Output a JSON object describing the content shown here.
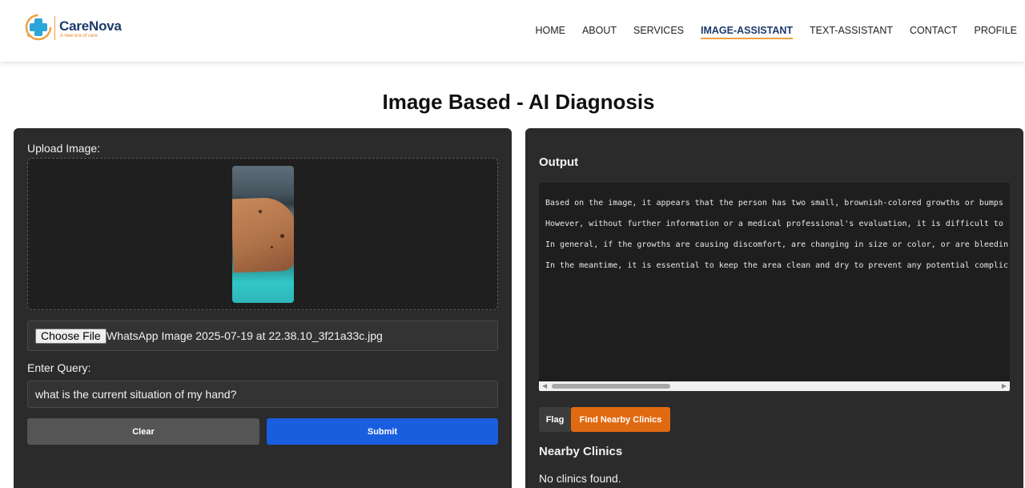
{
  "header": {
    "brand": "CareNova",
    "tagline": "A new era of care",
    "nav": [
      {
        "label": "HOME",
        "active": false
      },
      {
        "label": "ABOUT",
        "active": false
      },
      {
        "label": "SERVICES",
        "active": false
      },
      {
        "label": "IMAGE-ASSISTANT",
        "active": true
      },
      {
        "label": "TEXT-ASSISTANT",
        "active": false
      },
      {
        "label": "CONTACT",
        "active": false
      },
      {
        "label": "PROFILE",
        "active": false
      }
    ]
  },
  "page": {
    "title": "Image Based - AI Diagnosis"
  },
  "left_panel": {
    "upload_label": "Upload Image:",
    "choose_file_label": "Choose File",
    "file_name": "WhatsApp Image 2025-07-19 at 22.38.10_3f21a33c.jpg",
    "query_label": "Enter Query:",
    "query_value": "what is the current situation of my hand?",
    "clear_label": "Clear",
    "submit_label": "Submit"
  },
  "right_panel": {
    "output_title": "Output",
    "output_lines": [
      "Based on the image, it appears that the person has two small, brownish-colored growths or bumps",
      "However, without further information or a medical professional's evaluation, it is difficult to",
      "In general, if the growths are causing discomfort, are changing in size or color, or are bleedin",
      "In the meantime, it is essential to keep the area clean and dry to prevent any potential complic"
    ],
    "flag_label": "Flag",
    "find_clinics_label": "Find Nearby Clinics",
    "nearby_title": "Nearby Clinics",
    "no_clinics_text": "No clinics found."
  },
  "colors": {
    "panel_bg": "#2b2b2b",
    "submit_blue": "#1a5ee0",
    "clinics_orange": "#e06a12",
    "brand_navy": "#1e3a6b",
    "accent_orange": "#f0a040"
  }
}
